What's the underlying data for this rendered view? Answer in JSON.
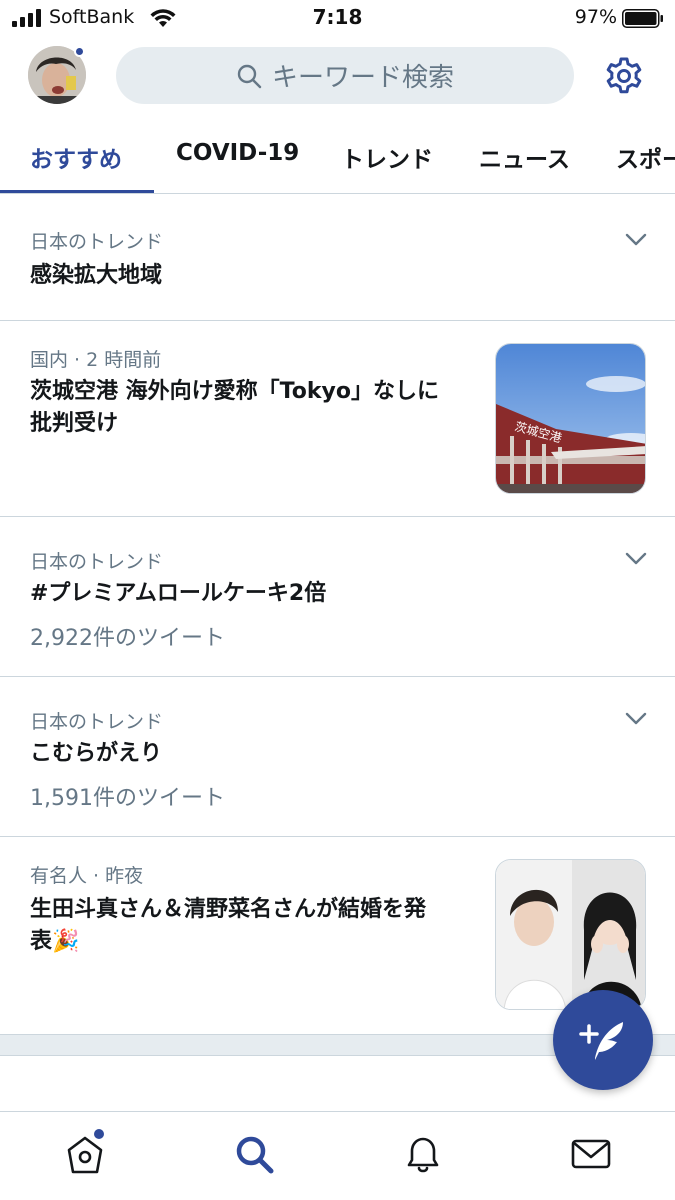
{
  "status_bar": {
    "carrier": "SoftBank",
    "time": "7:18",
    "battery": "97%"
  },
  "header": {
    "search_placeholder": "キーワード検索"
  },
  "tabs": [
    {
      "label": "おすすめ",
      "active": true
    },
    {
      "label": "COVID-19",
      "active": false
    },
    {
      "label": "トレンド",
      "active": false
    },
    {
      "label": "ニュース",
      "active": false
    },
    {
      "label": "スポー",
      "active": false
    }
  ],
  "feed": [
    {
      "meta": "日本のトレンド",
      "title": "感染拡大地域"
    },
    {
      "meta": "国内 · 2 時間前",
      "title_line1": "茨城空港 海外向け愛称「Tokyo」なしに",
      "title_line2": "批判受け",
      "thumb_text": "茨城空港"
    },
    {
      "meta": "日本のトレンド",
      "title": "#プレミアムロールケーキ2倍",
      "count": "2,922件のツイート"
    },
    {
      "meta": "日本のトレンド",
      "title": "こむらがえり",
      "count": "1,591件のツイート"
    },
    {
      "meta": "有名人 · 昨夜",
      "title_line1": "生田斗真さん＆清野菜名さんが結婚を発",
      "title_line2": "表🎉"
    }
  ],
  "colors": {
    "accent": "#2f4a9a",
    "text": "#14171a",
    "muted": "#657786",
    "divider": "#ccd6dd",
    "search_bg": "#e6ecf0"
  },
  "bottom_nav": {
    "items": [
      "home-icon",
      "search-icon",
      "bell-icon",
      "mail-icon"
    ],
    "active": "search-icon"
  }
}
